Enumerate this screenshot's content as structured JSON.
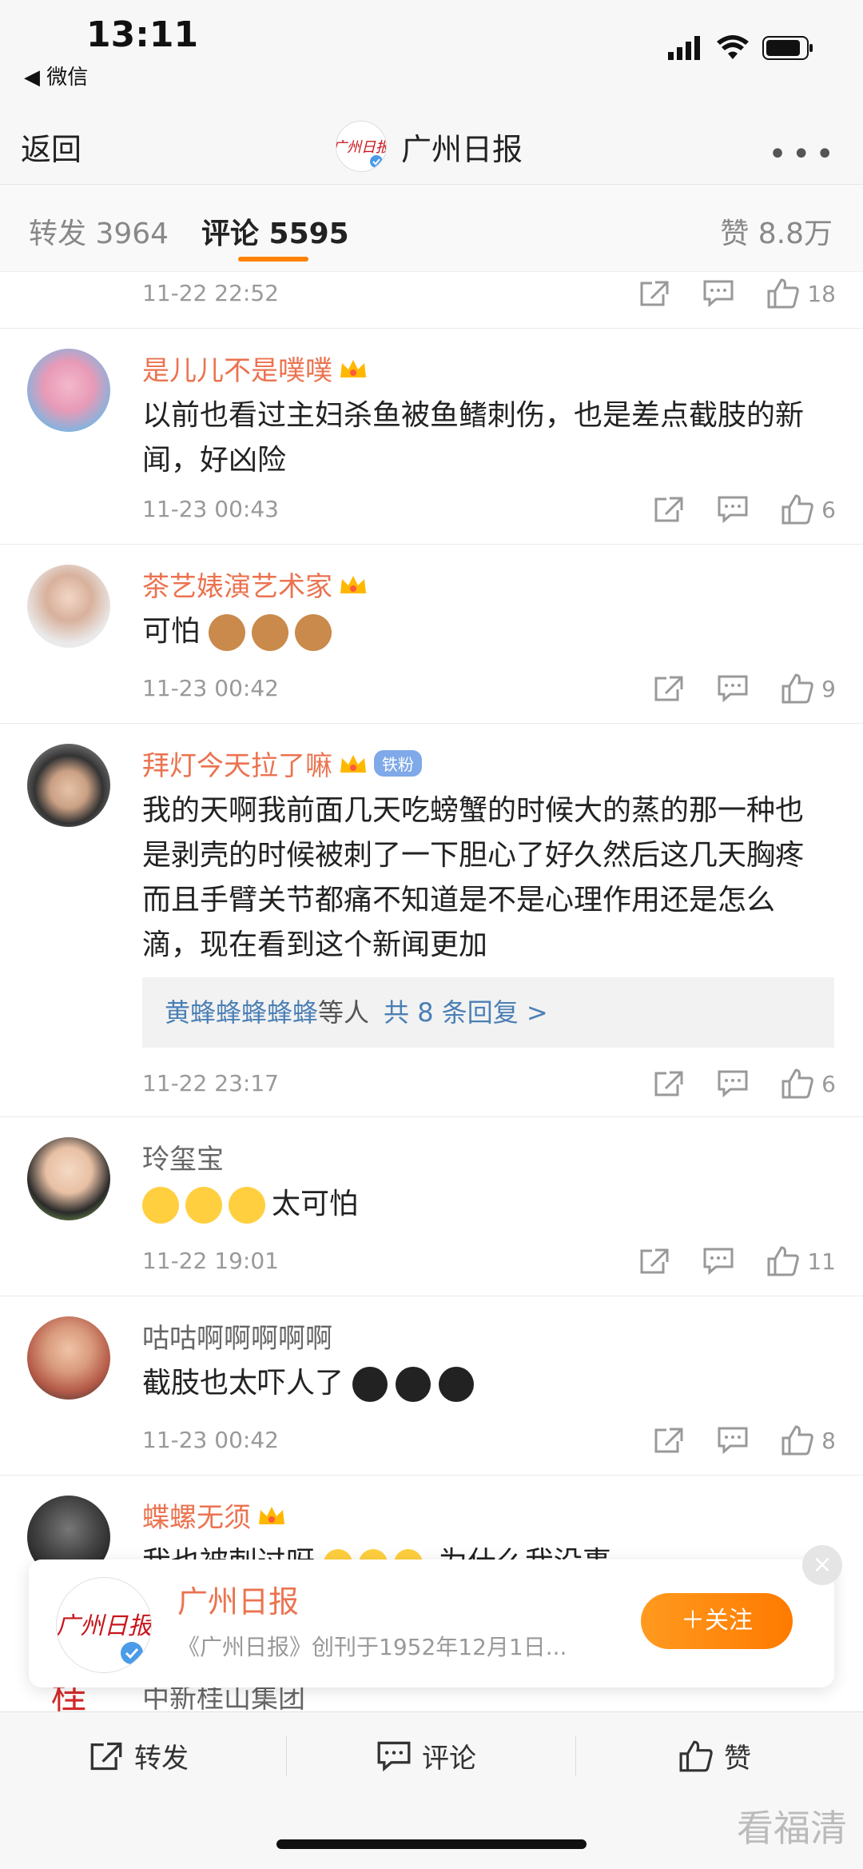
{
  "status": {
    "time": "13:11",
    "back_app": "◀ 微信"
  },
  "nav": {
    "back": "返回",
    "title": "广州日报",
    "more": "•••",
    "logo_text": "广州日报"
  },
  "tabs": {
    "repost": "转发 3964",
    "comment": "评论 5595",
    "like": "赞 8.8万"
  },
  "comments": [
    {
      "time": "11-22 22:52",
      "likes": "18"
    },
    {
      "name": "是儿儿不是噗噗",
      "text": "以前也看过主妇杀鱼被鱼鳍刺伤，也是差点截肢的新闻，好凶险",
      "time": "11-23 00:43",
      "likes": "6"
    },
    {
      "name": "茶艺婊演艺术家",
      "text": "可怕",
      "time": "11-23 00:42",
      "likes": "9"
    },
    {
      "name": "拜灯今天拉了嘛",
      "badge": "铁粉",
      "text": "我的天啊我前面几天吃螃蟹的时候大的蒸的那一种也是剥壳的时候被刺了一下胆心了好久然后这几天胸疼而且手臂关节都痛不知道是不是心理作用还是怎么滴，现在看到这个新闻更加",
      "reply_names": "黄蜂蜂蜂蜂蜂",
      "reply_etc": "等人",
      "reply_count": "共 8 条回复 >",
      "time": "11-22 23:17",
      "likes": "6"
    },
    {
      "name": "玲玺宝",
      "text": "太可怕",
      "time": "11-22 19:01",
      "likes": "11"
    },
    {
      "name": "咕咕啊啊啊啊啊",
      "text": "截肢也太吓人了",
      "time": "11-23 00:42",
      "likes": "8"
    },
    {
      "name": "蝶螺无须",
      "text": "我也被刺过呀",
      "text2": "为什么我没事"
    },
    {
      "name": "中新桂山集团"
    }
  ],
  "popup": {
    "close": "×",
    "name": "广州日报",
    "desc": "《广州日报》创刊于1952年12月1日...",
    "follow": "＋关注"
  },
  "bottom": {
    "repost": "转发",
    "comment": "评论",
    "like": "赞"
  },
  "watermark": "看福清",
  "colors": {
    "accent": "#ff8200",
    "username": "#eb7350",
    "link": "#4a7fb5"
  }
}
